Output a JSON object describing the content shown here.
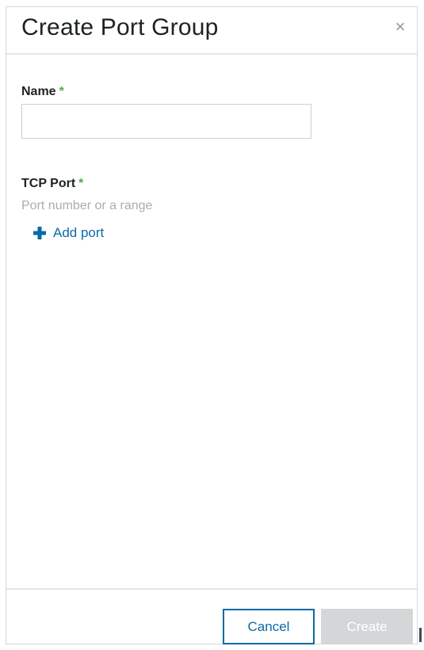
{
  "dialog": {
    "title": "Create Port Group",
    "close_glyph": "×",
    "close_icon": "close-icon"
  },
  "name_field": {
    "label": "Name",
    "required_mark": "*",
    "value": "",
    "placeholder": ""
  },
  "tcp_port_field": {
    "label": "TCP Port",
    "required_mark": "*",
    "hint": "Port number or a range"
  },
  "add_port": {
    "icon": "plus-icon",
    "label": "Add port"
  },
  "footer": {
    "cancel_label": "Cancel",
    "create_label": "Create",
    "create_disabled": true
  },
  "colors": {
    "accent": "#0a6aa7",
    "required": "#4caf50",
    "disabled_button": "#d4d6d7",
    "hint_text": "#a7aeb2"
  }
}
